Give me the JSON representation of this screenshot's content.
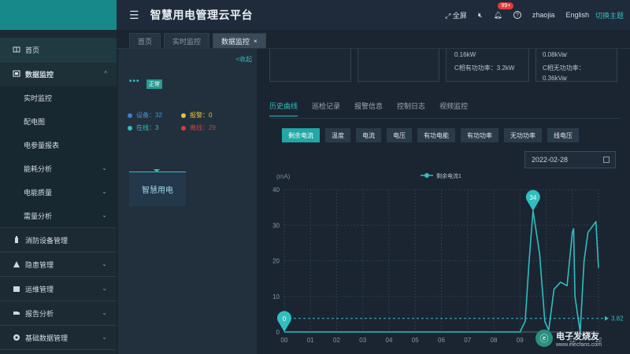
{
  "header": {
    "title": "智慧用电管理云平台",
    "fullscreen": "全屏",
    "badge": "99+",
    "help": "?",
    "user": "zhaojia",
    "language": "English",
    "theme": "切换主题"
  },
  "tabs": [
    {
      "label": "首页"
    },
    {
      "label": "实时监控"
    },
    {
      "label": "数据监控",
      "close": "×"
    }
  ],
  "sidebar": {
    "items": [
      {
        "label": "首页"
      },
      {
        "label": "数据监控",
        "arrow": "^"
      },
      {
        "label": "实时监控"
      },
      {
        "label": "配电图"
      },
      {
        "label": "电参量报表"
      },
      {
        "label": "能耗分析",
        "arrow": "⌄"
      },
      {
        "label": "电能质量",
        "arrow": "⌄"
      },
      {
        "label": "需量分析",
        "arrow": "⌄"
      },
      {
        "label": "消防设备管理"
      },
      {
        "label": "隐患管理",
        "arrow": "⌄"
      },
      {
        "label": "运维管理",
        "arrow": "⌄"
      },
      {
        "label": "报告分析",
        "arrow": "⌄"
      },
      {
        "label": "基础数据管理",
        "arrow": "⌄"
      }
    ]
  },
  "panel": {
    "collapse": "<收起",
    "dots": "•••",
    "status": "正常",
    "devices": "设备：32",
    "alarm": "报警：0",
    "online": "在线：3",
    "offline": "离线：29",
    "device_name": "智慧用电"
  },
  "cards": {
    "c1": "0.16kW",
    "c2": "C相有功功率：3.2kW",
    "c3": "0.08kVar",
    "c4": "C相无功功率：",
    "c5": "0.36kVar"
  },
  "subtabs": [
    "历史曲线",
    "巡检记录",
    "报警信息",
    "控制日志",
    "视频监控"
  ],
  "buttons": [
    "剩余电流",
    "温度",
    "电流",
    "电压",
    "有功电能",
    "有功功率",
    "无功功率",
    "线电压"
  ],
  "date": "2022-02-28",
  "watermark": {
    "title": "电子发烧友",
    "sub": "www.elecfans.com"
  },
  "colors": {
    "accent": "#2fbfbf",
    "alarm": "#e5c23a",
    "offline": "#d93b3b",
    "device": "#3a7fd0"
  },
  "chart_data": {
    "type": "line",
    "ylabel": "(mA)",
    "legend": "剩余电流1",
    "ylim": [
      0,
      40
    ],
    "yticks": [
      "0",
      "10",
      "20",
      "30",
      "40"
    ],
    "xticks": [
      "00",
      "01",
      "02",
      "03",
      "04",
      "05",
      "06",
      "07",
      "08",
      "09",
      "10",
      "11",
      "12"
    ],
    "series": [
      {
        "name": "剩余电流1",
        "x": [
          0,
          8.5,
          9.0,
          9.2,
          9.35,
          9.5,
          9.75,
          9.95,
          10.1,
          10.3,
          10.55,
          10.8,
          11.0,
          11.05,
          11.1,
          11.3,
          11.45,
          11.6,
          11.9,
          12.0
        ],
        "values": [
          0,
          0,
          0,
          3,
          20,
          34,
          22,
          3,
          0.5,
          12,
          14,
          13,
          28,
          29,
          10,
          0,
          20,
          28,
          31,
          18
        ]
      }
    ],
    "max_label": "34",
    "min_label": "0",
    "avg_label": "3.82",
    "avg_value": 3.82
  }
}
